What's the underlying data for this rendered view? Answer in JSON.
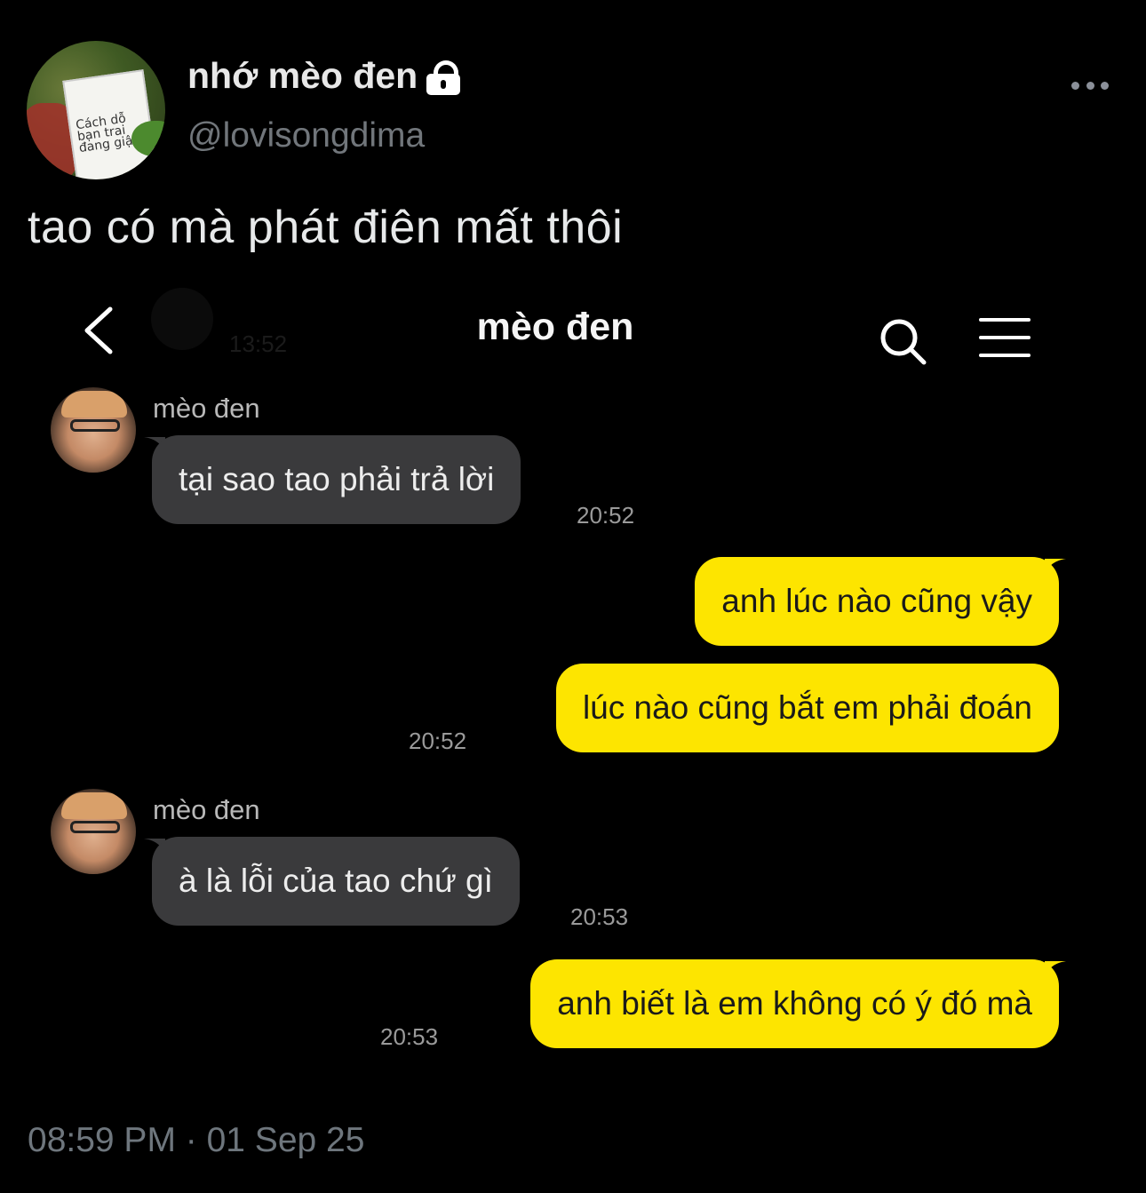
{
  "tweet": {
    "display_name": "nhớ mèo đen",
    "handle": "@lovisongdima",
    "text": "tao có mà phát điên mất thôi",
    "timestamp": "08:59 PM · 01 Sep 25",
    "avatar_book_text": "Cách dỗ bạn trai đang giận",
    "icons": {
      "lock": "lock-icon",
      "more": "more-icon"
    }
  },
  "chat": {
    "title": "mèo đen",
    "faded_time": "13:52",
    "icons": {
      "back": "back-icon",
      "search": "search-icon",
      "menu": "menu-icon"
    },
    "messages": [
      {
        "sender": "mèo đen",
        "text": "tại sao tao phải trả lời",
        "time": "20:52",
        "direction": "in"
      },
      {
        "text": "anh lúc nào cũng vậy",
        "direction": "out"
      },
      {
        "text": "lúc nào cũng bắt em phải đoán",
        "time": "20:52",
        "direction": "out"
      },
      {
        "sender": "mèo đen",
        "text": "à là lỗi của tao chứ gì",
        "time": "20:53",
        "direction": "in"
      },
      {
        "text": "anh biết là em không có ý đó mà",
        "time": "20:53",
        "direction": "out"
      }
    ],
    "colors": {
      "incoming_bubble": "#3a3a3c",
      "outgoing_bubble": "#fde500"
    }
  }
}
